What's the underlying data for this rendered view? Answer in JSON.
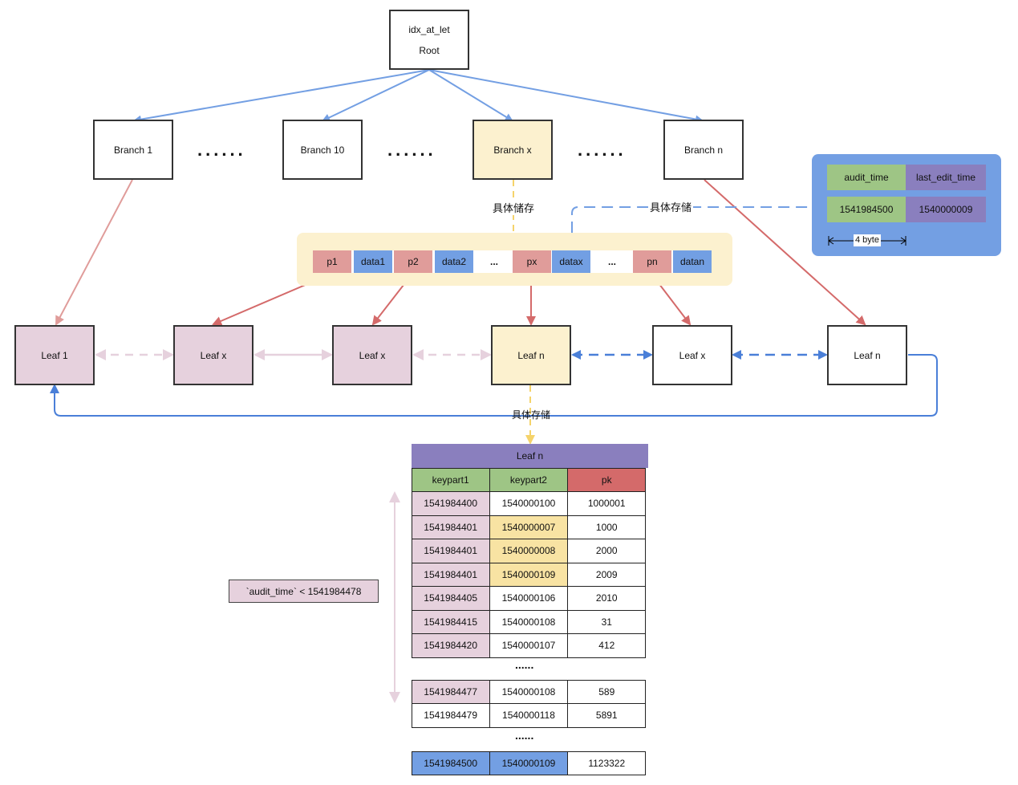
{
  "root": {
    "index_name": "idx_at_let",
    "label": "Root"
  },
  "branches": [
    {
      "label": "Branch 1"
    },
    {
      "label": "Branch 10"
    },
    {
      "label": "Branch x"
    },
    {
      "label": "Branch n"
    }
  ],
  "ellipsis_big": "......",
  "storage_labels": {
    "branch_storage": "具体储存",
    "data_storage": "具体存储",
    "leaf_storage": "具体存储"
  },
  "branch_node_entries": [
    "p1",
    "data1",
    "p2",
    "data2",
    "...",
    "px",
    "datax",
    "...",
    "pn",
    "datan"
  ],
  "leaves": [
    {
      "label": "Leaf 1"
    },
    {
      "label": "Leaf x"
    },
    {
      "label": "Leaf x"
    },
    {
      "label": "Leaf n"
    },
    {
      "label": "Leaf x"
    },
    {
      "label": "Leaf n"
    }
  ],
  "record_info": {
    "headers": [
      "audit_time",
      "last_edit_time"
    ],
    "values": [
      "1541984500",
      "1540000009"
    ],
    "size_label": "4 byte"
  },
  "leaf_table": {
    "title": "Leaf n",
    "columns": [
      "keypart1",
      "keypart2",
      "pk"
    ],
    "rows_group1": [
      [
        "1541984400",
        "1540000100",
        "1000001"
      ],
      [
        "1541984401",
        "1540000007",
        "1000"
      ],
      [
        "1541984401",
        "1540000008",
        "2000"
      ],
      [
        "1541984401",
        "1540000109",
        "2009"
      ],
      [
        "1541984405",
        "1540000106",
        "2010"
      ],
      [
        "1541984415",
        "1540000108",
        "31"
      ],
      [
        "1541984420",
        "1540000107",
        "412"
      ]
    ],
    "ellipsis": "......",
    "rows_group2": [
      [
        "1541984477",
        "1540000108",
        "589"
      ],
      [
        "1541984479",
        "1540000118",
        "5891"
      ]
    ],
    "rows_group3": [
      [
        "1541984500",
        "1540000109",
        "1123322"
      ]
    ]
  },
  "filter_condition": "`audit_time` < 1541984478",
  "colors": {
    "blue_arrow": "#739fe3",
    "red_arrow": "#d46a6a",
    "pink": "#e6d1dd",
    "yellow": "#fcf1cf",
    "green": "#9ec585",
    "purple": "#8a7fbe",
    "pk_red": "#d46a6a"
  }
}
